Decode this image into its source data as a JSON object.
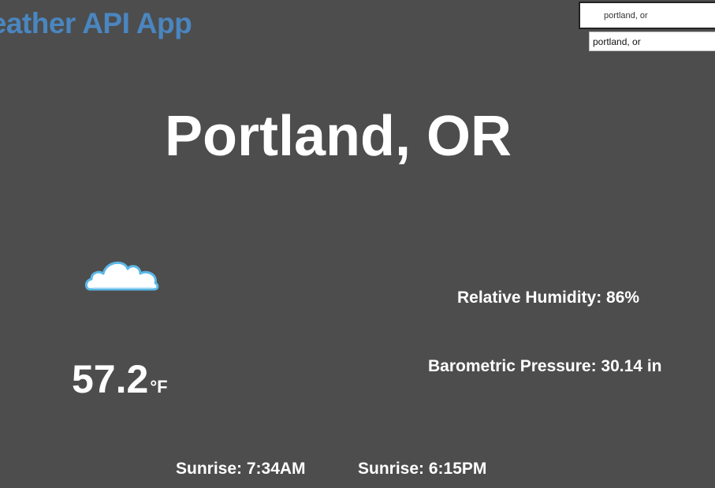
{
  "header": {
    "app_title": "Weather API App"
  },
  "search": {
    "value": "portland, or",
    "suggestion": "portland, or"
  },
  "location": {
    "city": "Portland, OR"
  },
  "current": {
    "icon": "cloud-icon",
    "temperature": "57.2",
    "temperature_unit": "°F",
    "humidity_text": "Relative Humidity: 86%",
    "pressure_text": "Barometric Pressure: 30.14 in"
  },
  "sun": {
    "sunrise_text": "Sunrise: 7:34AM",
    "sunset_text": "Sunrise: 6:15PM"
  },
  "colors": {
    "background": "#4d4d4d",
    "title": "#4a86c0",
    "text": "#ffffff",
    "cloud_fill": "#ffffff",
    "cloud_outline": "#5bb8e6"
  }
}
